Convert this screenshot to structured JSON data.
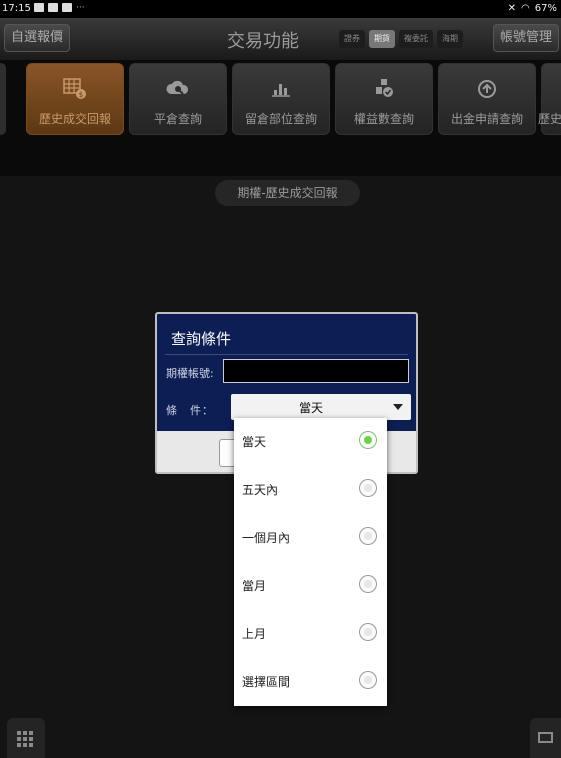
{
  "status_bar": {
    "time": "17:15",
    "battery": "67%"
  },
  "header": {
    "watchlist_button": "自選報價",
    "title": "交易功能",
    "segments": [
      "證券",
      "期貨",
      "複委託",
      "海期"
    ],
    "active_segment": "期貨",
    "account_button": "帳號管理"
  },
  "functions": [
    {
      "label": "歷史成交回報",
      "icon": "grid-dollar-icon",
      "active": true
    },
    {
      "label": "平倉查詢",
      "icon": "cloud-search-icon",
      "active": false
    },
    {
      "label": "留倉部位查詢",
      "icon": "bar-chart-icon",
      "active": false
    },
    {
      "label": "權益數查詢",
      "icon": "blocks-check-icon",
      "active": false
    },
    {
      "label": "出金申請查詢",
      "icon": "circle-arrow-icon",
      "active": false
    },
    {
      "label": "歷史",
      "icon": "partial-icon",
      "active": false
    }
  ],
  "page_title": "期權-歷史成交回報",
  "dialog": {
    "title": "查詢條件",
    "account_label": "期權帳號:",
    "account_value": "",
    "condition_label": "條　件：",
    "condition_value": "當天"
  },
  "dropdown": {
    "options": [
      "當天",
      "五天內",
      "一個月內",
      "當月",
      "上月",
      "選擇區間"
    ],
    "selected": "當天"
  },
  "colors": {
    "dialog_bg": "#0d1e55",
    "active_function": "#8a5526",
    "radio_selected": "#6cd24a"
  }
}
